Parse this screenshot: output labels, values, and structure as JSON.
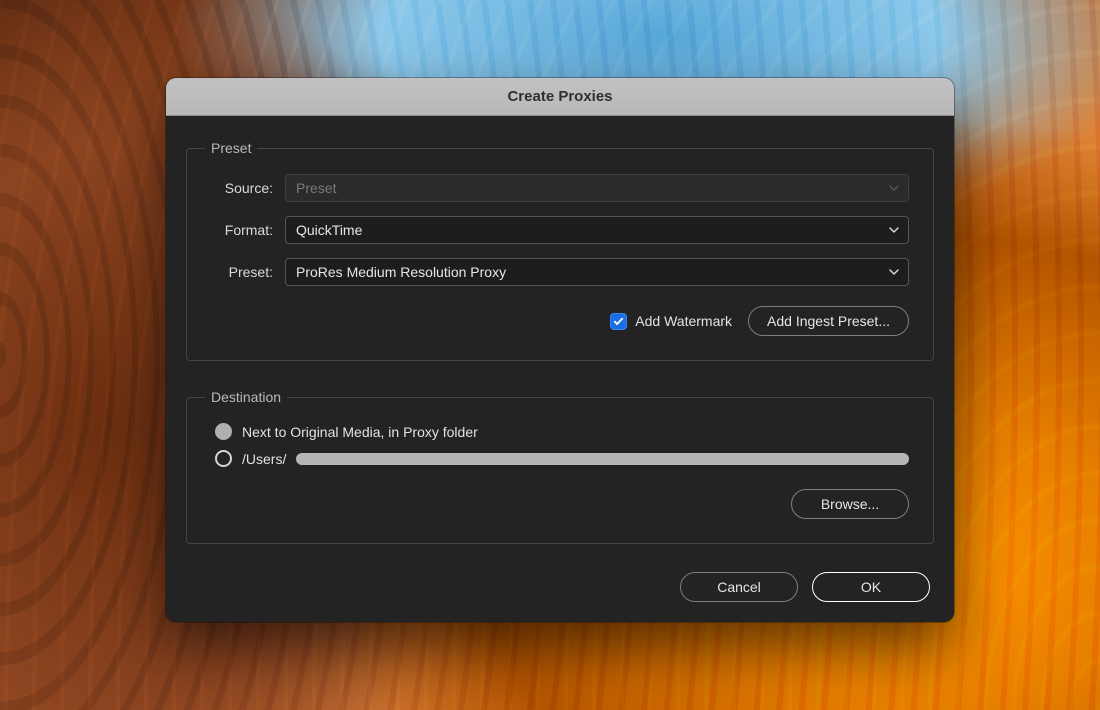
{
  "dialog": {
    "title": "Create Proxies",
    "preset_group": {
      "legend": "Preset",
      "rows": {
        "source": {
          "label": "Source:",
          "value": "Preset"
        },
        "format": {
          "label": "Format:",
          "value": "QuickTime"
        },
        "preset": {
          "label": "Preset:",
          "value": "ProRes Medium Resolution Proxy"
        }
      },
      "watermark_label": "Add Watermark",
      "watermark_checked": true,
      "add_ingest_label": "Add Ingest Preset..."
    },
    "destination_group": {
      "legend": "Destination",
      "option_next_to": "Next to Original Media, in Proxy folder",
      "option_path_prefix": "/Users/",
      "browse_label": "Browse..."
    },
    "footer": {
      "cancel": "Cancel",
      "ok": "OK"
    }
  }
}
